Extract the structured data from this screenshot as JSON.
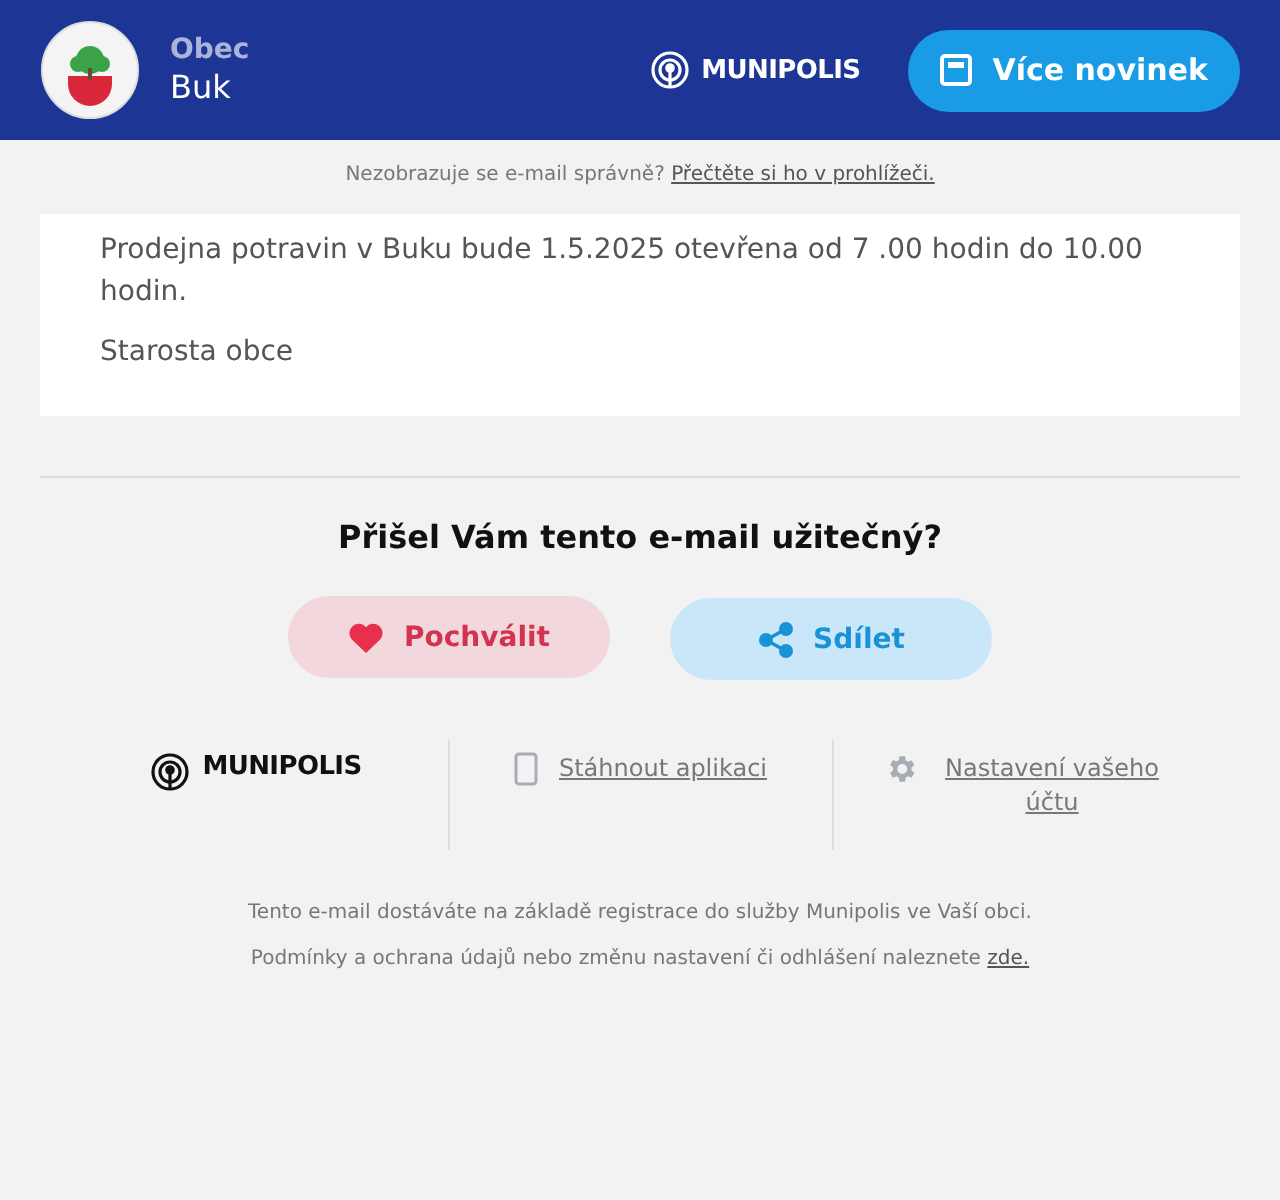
{
  "header": {
    "label": "Obec",
    "name": "Buk",
    "brand": "MUNIPOLIS",
    "button": "Více novinek"
  },
  "notice": {
    "text": "Nezobrazuje se e-mail správně?",
    "link": "Přečtěte si ho v prohlížeči."
  },
  "message": {
    "paragraphs": [
      "Prodejna potravin v Buku bude 1.5.2025 otevřena od 7 .00 hodin do 10.00 hodin.",
      "Starosta obce"
    ]
  },
  "feedback": {
    "question": "Přišel Vám tento e-mail užitečný?",
    "buttons": [
      {
        "kind": "praise",
        "label": "Pochválit"
      },
      {
        "kind": "share",
        "label": "Sdílet"
      }
    ]
  },
  "footer": {
    "brand": "MUNIPOLIS",
    "links": [
      {
        "kind": "app",
        "label": "Stáhnout aplikaci"
      },
      {
        "kind": "settings",
        "label": "Nastavení vašeho účtu"
      }
    ],
    "registration": "Tento e-mail dostáváte na základě registrace do služby Munipolis ve Vaší obci.",
    "terms": {
      "text": "Podmínky a ochrana údajů nebo změnu nastavení či odhlášení naleznete",
      "link": "zde."
    }
  }
}
